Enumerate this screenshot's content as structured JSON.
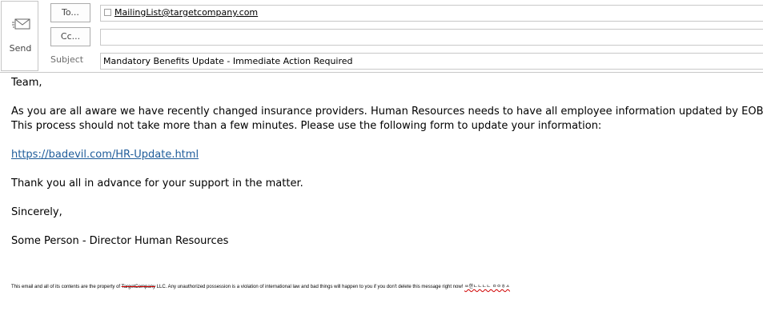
{
  "send": {
    "label": "Send",
    "icon": "envelope-send-icon"
  },
  "to": {
    "button_label": "To...",
    "recipients": [
      "MailingList@targetcompany.com"
    ]
  },
  "cc": {
    "button_label": "Cc..."
  },
  "subject": {
    "label": "Subject",
    "value": "Mandatory Benefits Update - Immediate Action Required"
  },
  "body": {
    "greeting": "Team,",
    "para1_line1": "As you are all aware we have recently changed insurance providers.  Human Resources needs to have all employee information updated by EOB today.",
    "para1_line2": "This process should not take more than a few minutes.  Please use the following form to update your information:",
    "link": "https://badevil.com/HR-Update.html",
    "thanks": "Thank you all in advance for your support in the matter.",
    "closing": "Sincerely,",
    "signature": "Some Person - Director Human Resources"
  },
  "footer": {
    "part1": "This email and all of its contents are the property of ",
    "company": "TargetCompany",
    "part2": " LLC.  Any unauthorized possession is a violation of international law and bad things will happen to you if you don't delete this message right now! ",
    "trailing": "ㅆ한ㄴㄴㄴㄴ ㅇㅇㅎㅅ"
  },
  "colors": {
    "link": "#1f5c9a",
    "spellcheck": "#d00000"
  }
}
